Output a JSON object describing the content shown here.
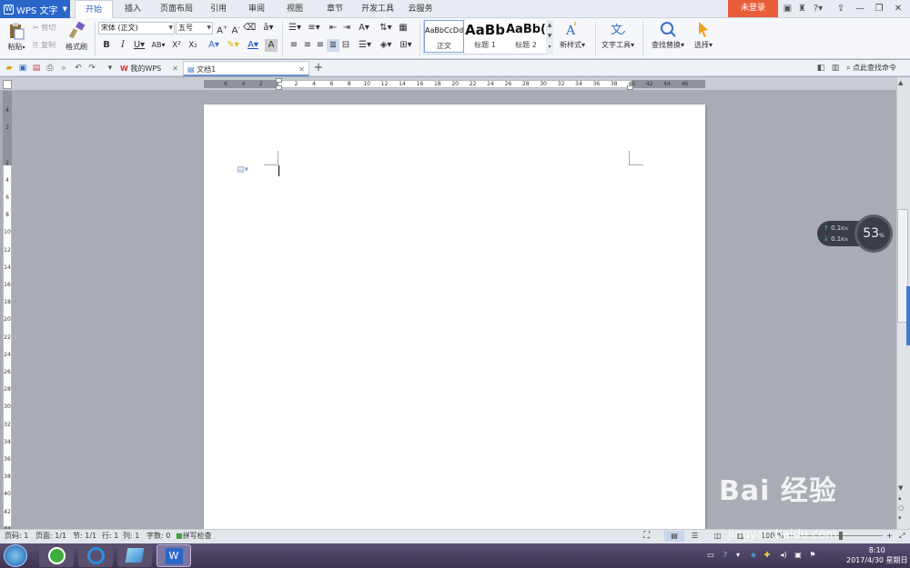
{
  "app": {
    "name": "WPS 文字"
  },
  "ribbon_tabs": [
    "开始",
    "插入",
    "页面布局",
    "引用",
    "审阅",
    "视图",
    "章节",
    "开发工具",
    "云服务"
  ],
  "active_tab": "开始",
  "login_button": "未登录",
  "window_controls": {
    "help": "?"
  },
  "clipboard": {
    "paste": "粘贴",
    "cut": "剪切",
    "copy": "复制",
    "format_painter": "格式刷"
  },
  "font": {
    "name": "宋体 (正文)",
    "size": "五号"
  },
  "styles": [
    {
      "preview": "AaBbCcDd",
      "name": "正文"
    },
    {
      "preview": "AaBb",
      "name": "标题 1"
    },
    {
      "preview": "AaBb(",
      "name": "标题 2"
    }
  ],
  "ribbon_buttons": {
    "new_style": "新样式",
    "text_tools": "文字工具",
    "find_replace": "查找替换",
    "select": "选择"
  },
  "doc_tabs": [
    {
      "label": "我的WPS"
    },
    {
      "label": "文档1"
    }
  ],
  "command_search": "点此查找命令",
  "ruler": {
    "h_ticks": [
      "6",
      "4",
      "2",
      "",
      "2",
      "4",
      "6",
      "8",
      "10",
      "12",
      "14",
      "16",
      "18",
      "20",
      "22",
      "24",
      "26",
      "28",
      "30",
      "32",
      "34",
      "36",
      "38",
      "40",
      "42",
      "44",
      "46"
    ],
    "v_ticks": [
      "4",
      "2",
      "",
      "2",
      "4",
      "6",
      "8",
      "10",
      "12",
      "14",
      "16",
      "18",
      "20",
      "22",
      "24",
      "26",
      "28",
      "30",
      "32",
      "34",
      "36",
      "38",
      "40",
      "42",
      "44",
      "46"
    ]
  },
  "speed_widget": {
    "up": "0.1",
    "down": "0.1",
    "unit": "K/s",
    "percent": "53",
    "percent_sign": "%"
  },
  "status": {
    "page_code": "页码: 1",
    "pages": "页面: 1/1",
    "section": "节: 1/1",
    "row": "行: 1",
    "col": "列: 1",
    "words": "字数: 0",
    "spell": "拼写检查",
    "zoom": "100 %"
  },
  "taskbar": {
    "time": "8:10",
    "date": "2017/4/30 星期日"
  },
  "watermark": {
    "brand": "Bai 经验",
    "url": "jingyan.baidu.com"
  },
  "colors": {
    "accent": "#2b66c9",
    "login": "#e85d3a",
    "taskbar": "#4a3f60"
  }
}
